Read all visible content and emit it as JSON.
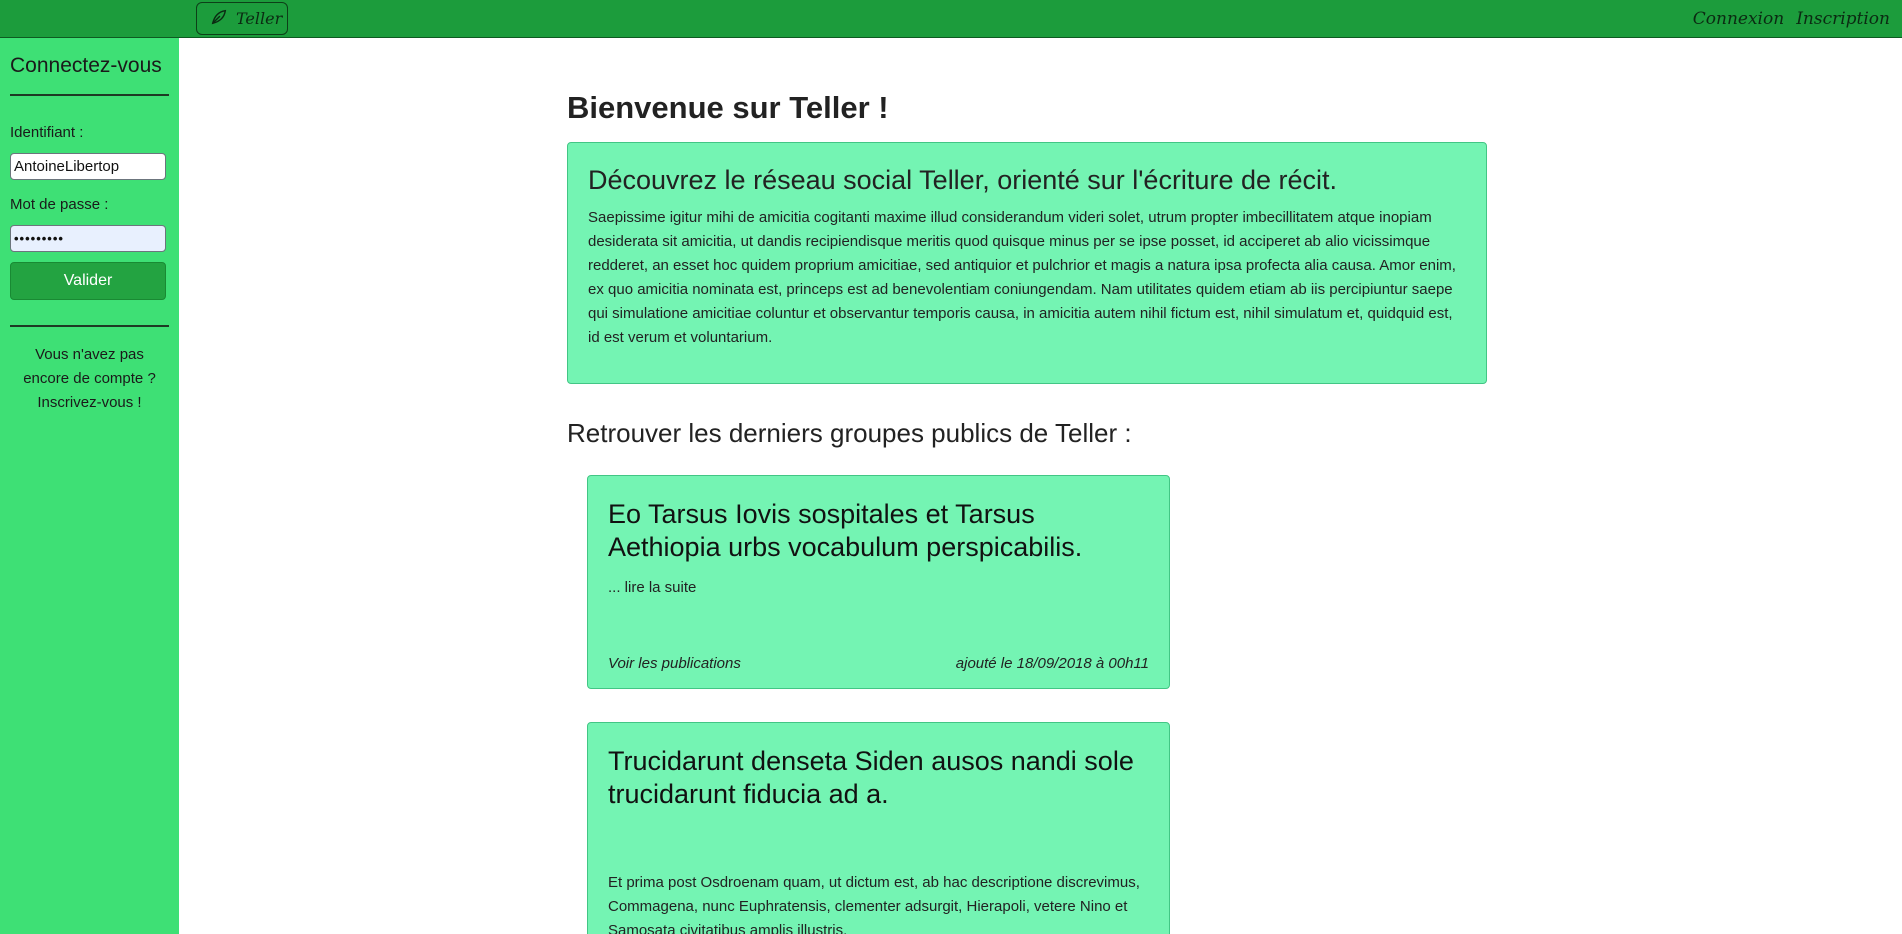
{
  "navbar": {
    "brand": "Teller",
    "brand_icon": "leaf-icon",
    "links": [
      "Connexion",
      "Inscription"
    ]
  },
  "sidebar": {
    "title": "Connectez-vous",
    "username_label": "Identifiant :",
    "username_value": "AntoineLibertop",
    "password_label": "Mot de passe :",
    "password_value": "•••••••••",
    "submit_label": "Valider",
    "no_account_text": "Vous n'avez pas encore de compte ?",
    "signup_link": "Inscrivez-vous !"
  },
  "main": {
    "welcome_title": "Bienvenue sur Teller !",
    "intro": {
      "heading": "Découvrez le réseau social Teller, orienté sur l'écriture de récit.",
      "body": "Saepissime igitur mihi de amicitia cogitanti maxime illud considerandum videri solet, utrum propter imbecillitatem atque inopiam desiderata sit amicitia, ut dandis recipiendisque meritis quod quisque minus per se ipse posset, id acciperet ab alio vicissimque redderet, an esset hoc quidem proprium amicitiae, sed antiquior et pulchrior et magis a natura ipsa profecta alia causa. Amor enim, ex quo amicitia nominata est, princeps est ad benevolentiam coniungendam. Nam utilitates quidem etiam ab iis percipiuntur saepe qui simulatione amicitiae coluntur et observantur temporis causa, in amicitia autem nihil fictum est, nihil simulatum et, quidquid est, id est verum et voluntarium."
    },
    "groups_title": "Retrouver les derniers groupes publics de Teller :",
    "groups": [
      {
        "title": "Eo Tarsus Iovis sospitales et Tarsus Aethiopia urbs vocabulum perspicabilis.",
        "excerpt": "... lire la suite",
        "link": "Voir les publications",
        "date": "ajouté le 18/09/2018 à 00h11"
      },
      {
        "title": "Trucidarunt denseta Siden ausos nandi sole trucidarunt fiducia ad a.",
        "excerpt": "Et prima post Osdroenam quam, ut dictum est, ab hac descriptione discrevimus, Commagena, nunc Euphratensis, clementer adsurgit, Hierapoli, vetere Nino et Samosata civitatibus amplis illustris."
      }
    ]
  },
  "colors": {
    "navbar": "#1c9c3c",
    "sidebar": "#3ee075",
    "card": "#74f4b3",
    "button": "#23a341"
  }
}
